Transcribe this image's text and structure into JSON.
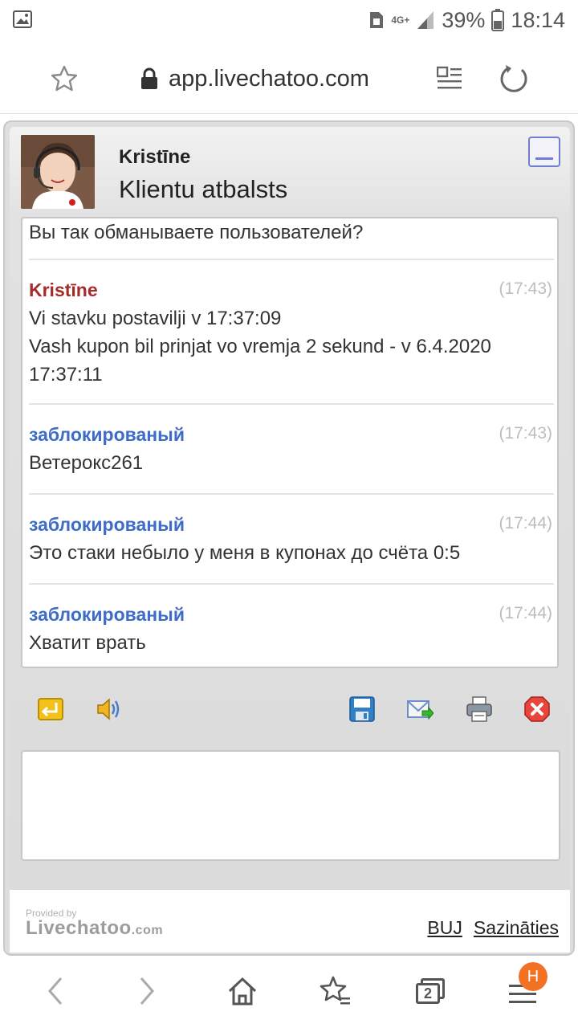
{
  "status_bar": {
    "network": "4G+",
    "battery": "39%",
    "time": "18:14"
  },
  "browser": {
    "url": "app.livechatoo.com",
    "tab_count": "2",
    "badge": "H"
  },
  "chat": {
    "agent_name": "Kristīne",
    "department": "Klientu atbalsts",
    "messages": [
      {
        "text_lines": [
          "Вы так обманываете пользователей?"
        ]
      },
      {
        "author": "Kristīne",
        "time": "(17:43)",
        "text_lines": [
          "Vi stavku postavilji v 17:37:09",
          "Vash kupon bil prinjat vo vremja 2 sekund - v 6.4.2020",
          "17:37:11"
        ]
      },
      {
        "author": "заблокированый",
        "time": "(17:43)",
        "text_lines": [
          "Ветерокс261"
        ]
      },
      {
        "author": "заблокированый",
        "time": "(17:44)",
        "text_lines": [
          "Это стаки небыло у меня в купонах до счёта 0:5"
        ]
      },
      {
        "author": "заблокированый",
        "time": "(17:44)",
        "text_lines": [
          "Хватит врать"
        ]
      }
    ],
    "input_value": ""
  },
  "footer": {
    "provided_by": "Provided by",
    "brand": "Livechatoo",
    "brand_suffix": ".com",
    "link_buj": "BUJ",
    "link_contact": "Sazināties"
  },
  "colors": {
    "agent": "#a52a2a",
    "visitor": "#3d6cc9",
    "badge": "#f07222"
  },
  "icons": [
    "gallery-icon",
    "star-icon",
    "lock-icon",
    "reader-icon",
    "reload-icon",
    "minimize-icon",
    "exit-icon",
    "sound-icon",
    "save-icon",
    "email-icon",
    "print-icon",
    "close-icon",
    "back-icon",
    "forward-icon",
    "home-icon",
    "bookmarks-icon",
    "tabs-icon",
    "menu-icon"
  ]
}
